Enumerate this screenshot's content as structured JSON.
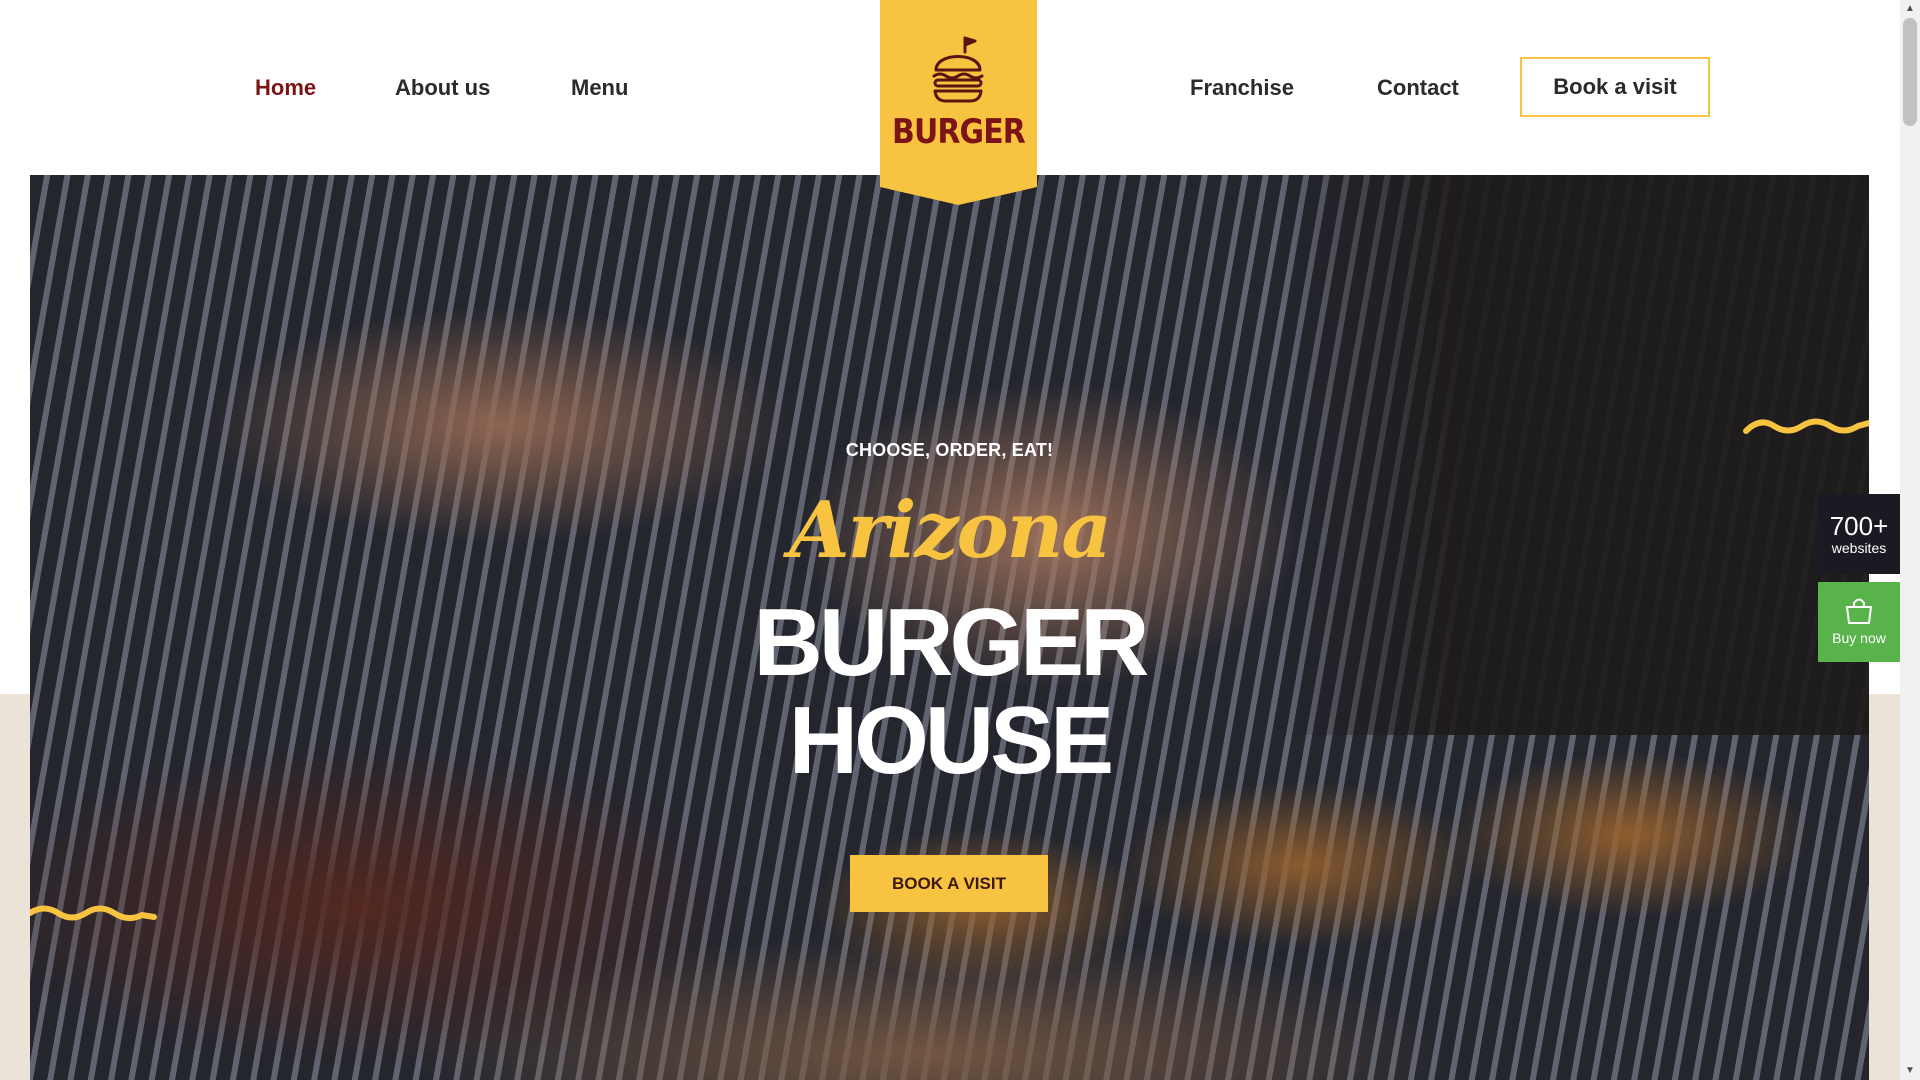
{
  "nav": {
    "left": [
      "Home",
      "About us",
      "Menu"
    ],
    "right": [
      "Franchise",
      "Contact"
    ],
    "active": "Home",
    "book_button": "Book a visit"
  },
  "logo": {
    "text": "BURGER",
    "icon": "burger-icon"
  },
  "hero": {
    "eyebrow": "CHOOSE, ORDER, EAT!",
    "script_title": "Arizona",
    "title_line1": "BURGER",
    "title_line2": "HOUSE",
    "cta": "BOOK A VISIT"
  },
  "side_widgets": {
    "sites_count": "700+",
    "sites_label": "websites",
    "buy_label": "Buy now",
    "buy_icon": "shopping-bag-icon"
  },
  "colors": {
    "accent": "#f7c340",
    "brand": "#7a1416",
    "buy": "#58b44a",
    "beige": "#ece3d8"
  }
}
